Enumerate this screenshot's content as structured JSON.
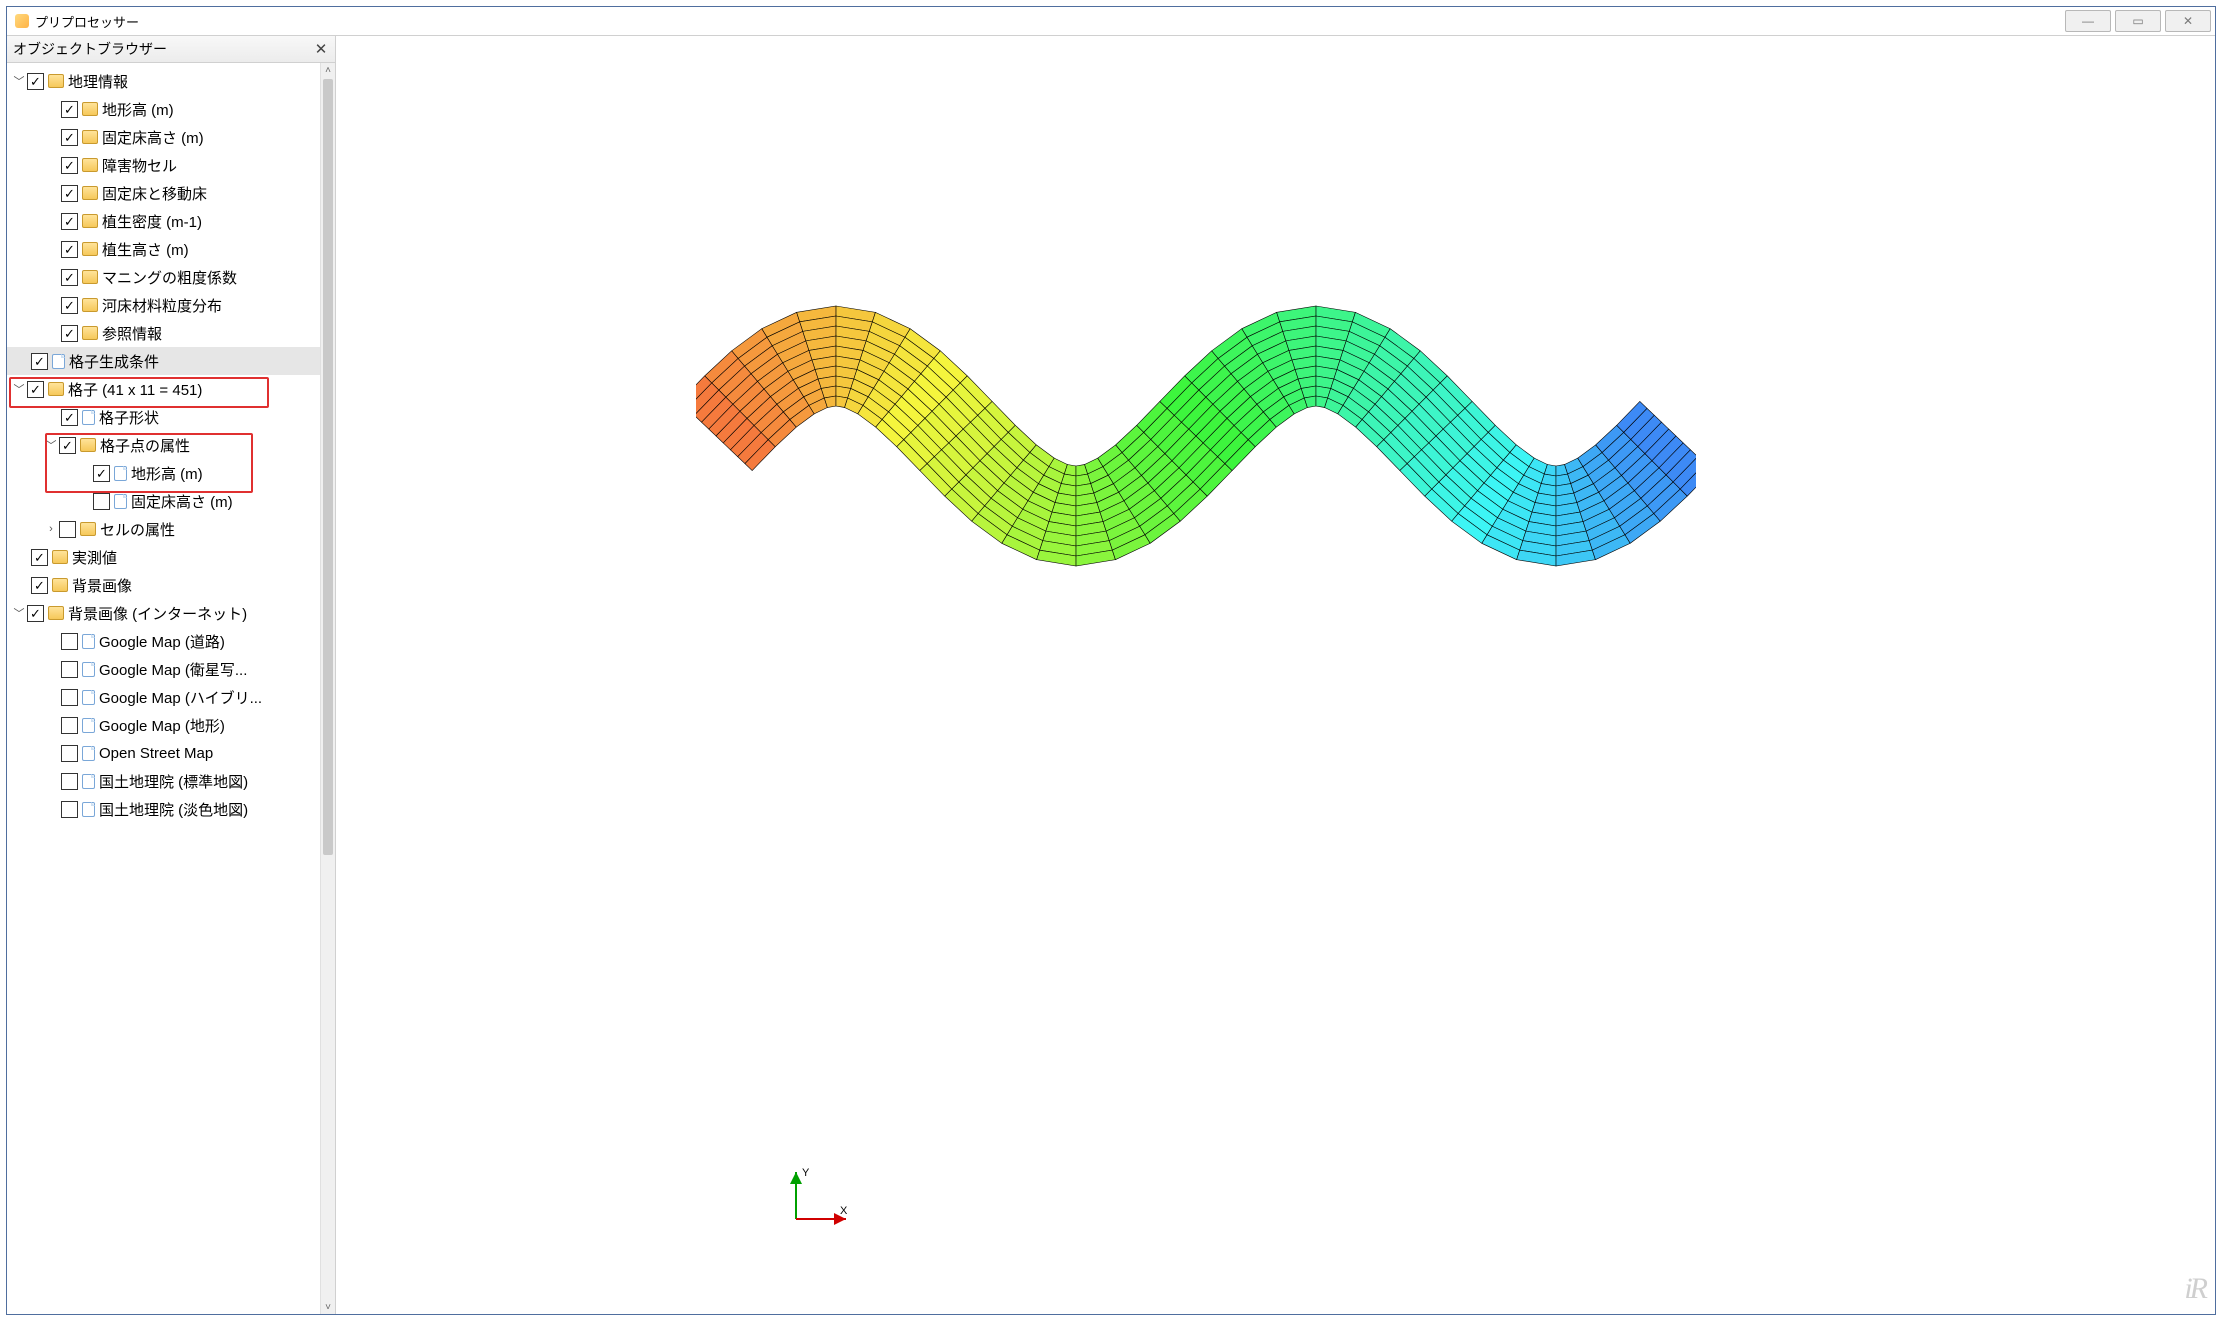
{
  "window": {
    "title": "プリプロセッサー"
  },
  "pane": {
    "title": "オブジェクトブラウザー"
  },
  "tree": {
    "root1": "地理情報",
    "geo": {
      "elev": "地形高 (m)",
      "fixedbed_h": "固定床高さ (m)",
      "obstacle": "障害物セル",
      "fixed_moving": "固定床と移動床",
      "veg_density": "植生密度 (m-1)",
      "veg_height": "植生高さ (m)",
      "manning": "マニングの粗度係数",
      "grain": "河床材料粒度分布",
      "refinfo": "参照情報"
    },
    "grid_cond": "格子生成条件",
    "grid": "格子 (41 x 11 = 451)",
    "grid_shape": "格子形状",
    "grid_pt_attr": "格子点の属性",
    "gp_elev": "地形高 (m)",
    "gp_fixedbed": "固定床高さ (m)",
    "cell_attr": "セルの属性",
    "measured": "実測値",
    "bgimg": "背景画像",
    "bgnet": "背景画像 (インターネット)",
    "maps": {
      "g_road": "Google Map (道路)",
      "g_sat": "Google Map (衛星写...",
      "g_hyb": "Google Map (ハイブリ...",
      "g_terr": "Google Map (地形)",
      "osm": "Open Street Map",
      "gsi_std": "国土地理院 (標準地図)",
      "gsi_pale": "国土地理院 (淡色地図)"
    }
  },
  "axis": {
    "x": "X",
    "y": "Y"
  }
}
